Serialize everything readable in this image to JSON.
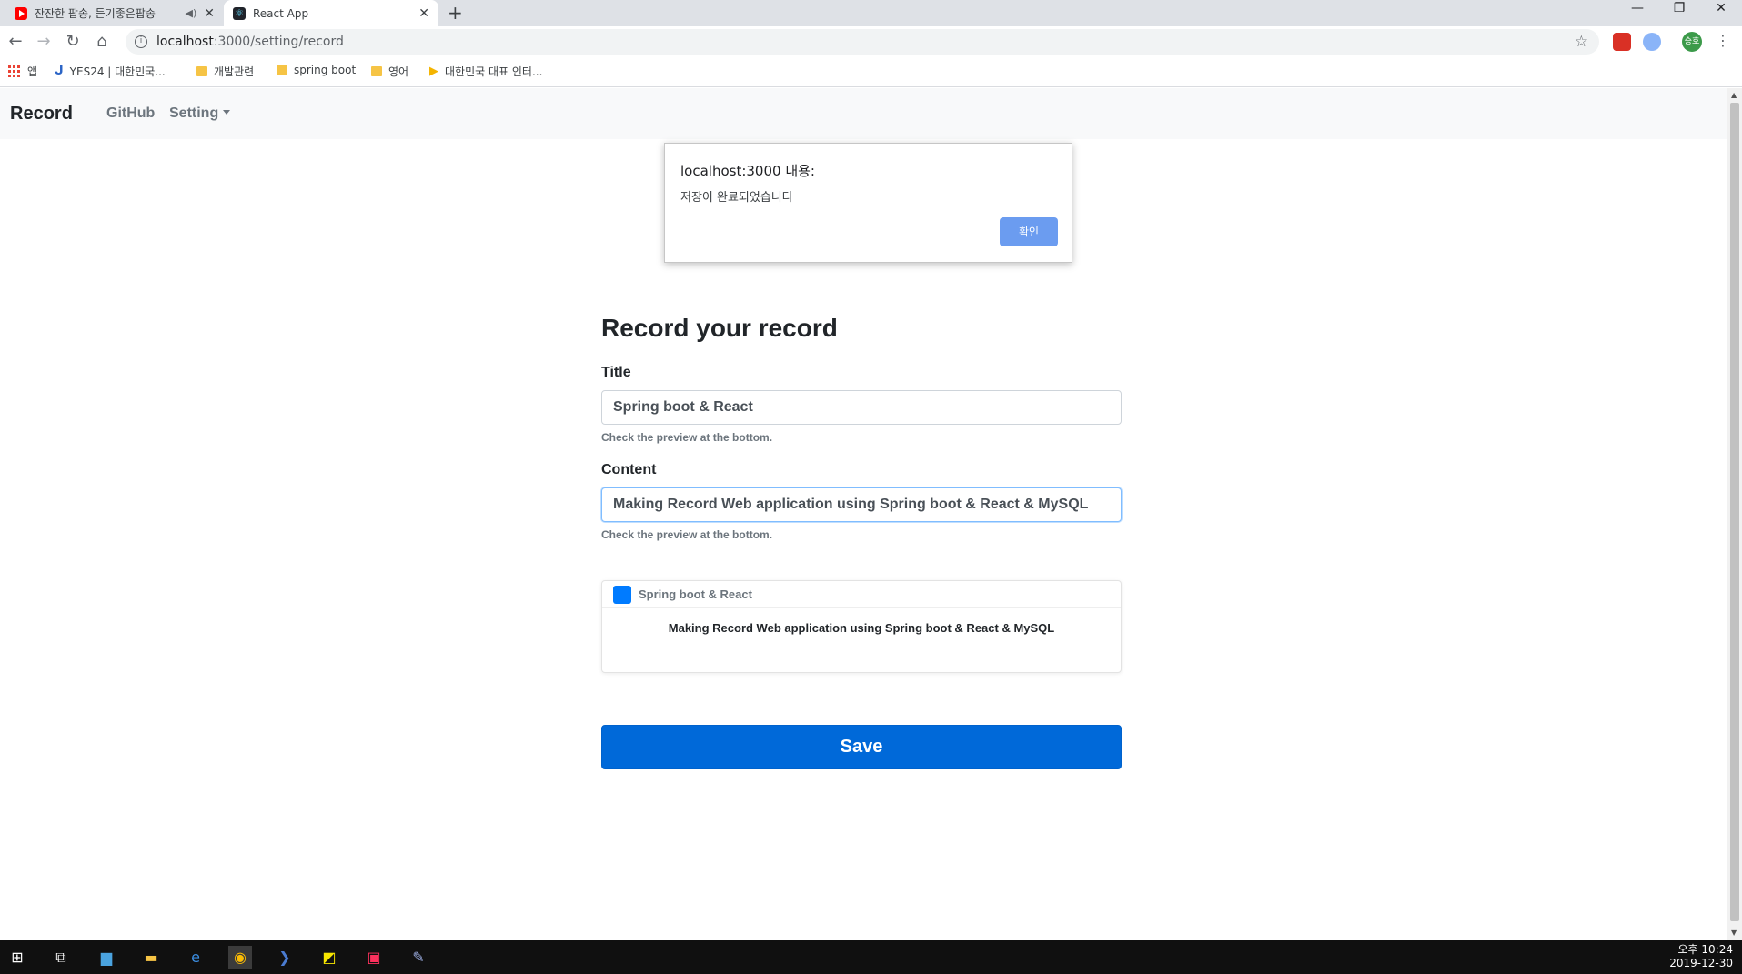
{
  "browser": {
    "tabs": [
      {
        "title": "잔잔한 팝송, 듣기좋은팝송",
        "favicon": "youtube-icon",
        "sound": "speaker-icon"
      },
      {
        "title": "React App",
        "favicon": "react-icon"
      }
    ],
    "new_tab": "+",
    "window_controls": {
      "minimize": "—",
      "restore": "❐",
      "close": "✕"
    },
    "url_host": "localhost",
    "url_path": ":3000/setting/record",
    "bookmarks": [
      "앱",
      "YES24 | 대한민국...",
      "개발관련",
      "spring boot",
      "영어",
      "대한민국 대표 인터..."
    ],
    "profile_initials": "승호"
  },
  "app": {
    "brand": "Record",
    "nav": {
      "github": "GitHub",
      "setting": "Setting"
    }
  },
  "form": {
    "heading": "Record your record",
    "title_label": "Title",
    "title_value": "Spring boot & React",
    "title_help": "Check the preview at the bottom.",
    "content_label": "Content",
    "content_value": "Making Record Web application using Spring boot & React & MySQL",
    "content_help": "Check the preview at the bottom.",
    "save_label": "Save"
  },
  "preview": {
    "title": "Spring boot & React",
    "body": "Making Record Web application using Spring boot & React & MySQL"
  },
  "dialog": {
    "title": "localhost:3000 내용:",
    "message": "저장이 완료되었습니다",
    "ok_label": "확인"
  },
  "taskbar": {
    "time": "오후 10:24",
    "date": "2019-12-30"
  },
  "colors": {
    "primary": "#0069d9",
    "preview_square": "#007bff",
    "dialog_button": "#6b9cf0"
  }
}
